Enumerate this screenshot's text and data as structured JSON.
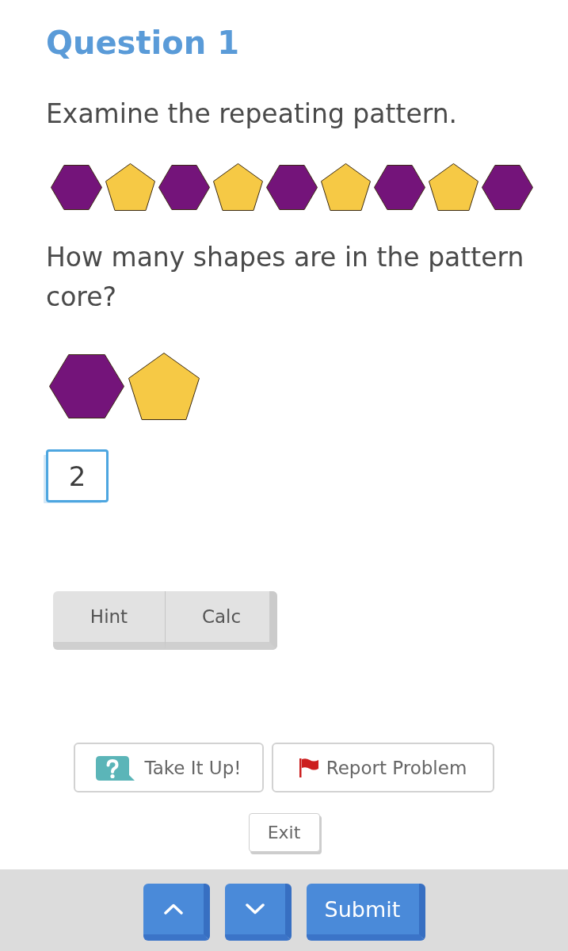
{
  "question": {
    "title": "Question 1",
    "prompt": "Examine the repeating pattern.",
    "pattern": [
      {
        "kind": "hexagon",
        "color": "#74147a"
      },
      {
        "kind": "pentagon",
        "color": "#f6c945"
      },
      {
        "kind": "hexagon",
        "color": "#74147a"
      },
      {
        "kind": "pentagon",
        "color": "#f6c945"
      },
      {
        "kind": "hexagon",
        "color": "#74147a"
      },
      {
        "kind": "pentagon",
        "color": "#f6c945"
      },
      {
        "kind": "hexagon",
        "color": "#74147a"
      },
      {
        "kind": "pentagon",
        "color": "#f6c945"
      },
      {
        "kind": "hexagon",
        "color": "#74147a"
      }
    ],
    "text": "How many shapes are in the pattern core?",
    "core": [
      {
        "kind": "hexagon",
        "color": "#74147a"
      },
      {
        "kind": "pentagon",
        "color": "#f6c945"
      }
    ],
    "answer": {
      "value": "2"
    }
  },
  "tools": [
    {
      "label": "Hint"
    },
    {
      "label": "Calc"
    }
  ],
  "actions": [
    {
      "kind": "help",
      "label": "Take It Up!"
    },
    {
      "kind": "report",
      "label": "Report Problem"
    }
  ],
  "exit": {
    "label": "Exit"
  },
  "footer": {
    "buttons": [
      {
        "kind": "up"
      },
      {
        "kind": "down"
      },
      {
        "kind": "submit",
        "label": "Submit"
      }
    ]
  }
}
